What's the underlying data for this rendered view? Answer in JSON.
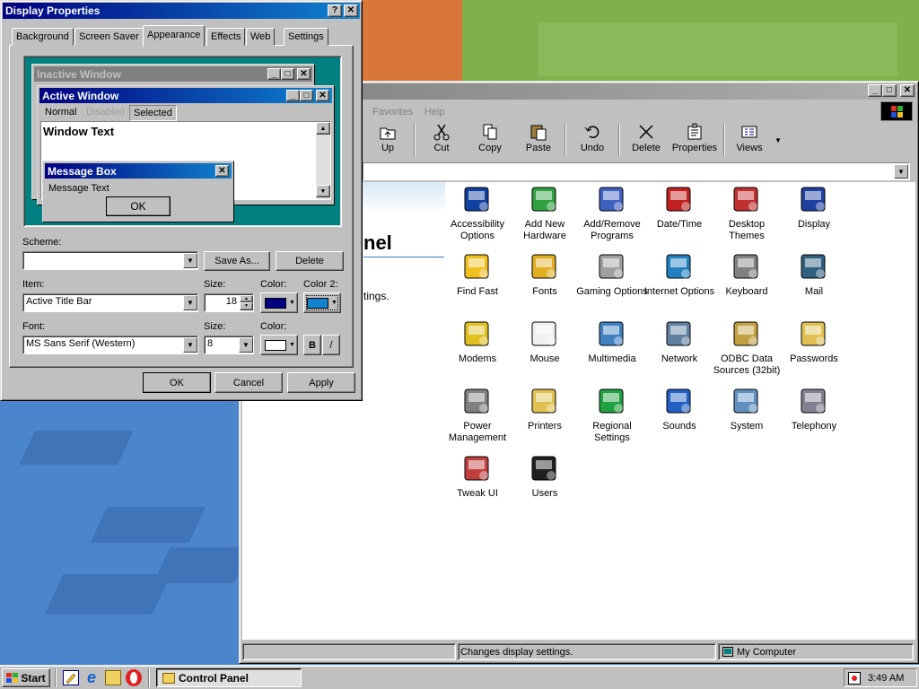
{
  "display_properties": {
    "title": "Display Properties",
    "help_btn": "?",
    "close_btn": "✕",
    "tabs": [
      "Background",
      "Screen Saver",
      "Appearance",
      "Effects",
      "Web",
      "Settings"
    ],
    "preview": {
      "inactive_title": "Inactive Window",
      "active_title": "Active Window",
      "menu": [
        "Normal",
        "Disabled",
        "Selected"
      ],
      "window_text": "Window Text",
      "msgbox_title": "Message Box",
      "msgbox_text": "Message Text",
      "msgbox_ok": "OK"
    },
    "scheme_label": "Scheme:",
    "scheme_value": "",
    "save_as": "Save As...",
    "delete": "Delete",
    "item_label": "Item:",
    "item_value": "Active Title Bar",
    "size_label": "Size:",
    "item_size": "18",
    "color_label": "Color:",
    "color2_label": "Color 2:",
    "font_label": "Font:",
    "font_value": "MS Sans Serif (Western)",
    "font_size_label": "Size:",
    "font_size": "8",
    "font_color_label": "Color:",
    "bold_btn": "B",
    "italic_btn": "/",
    "ok": "OK",
    "cancel": "Cancel",
    "apply": "Apply"
  },
  "control_panel": {
    "menu": [
      "Favorites",
      "Help"
    ],
    "toolbar": [
      "Up",
      "Cut",
      "Copy",
      "Paste",
      "Undo",
      "Delete",
      "Properties",
      "Views"
    ],
    "side_title": "nel",
    "side_text": "tings.",
    "items": [
      "Accessibility Options",
      "Add New Hardware",
      "Add/Remove Programs",
      "Date/Time",
      "Desktop Themes",
      "Display",
      "Find Fast",
      "Fonts",
      "Gaming Options",
      "Internet Options",
      "Keyboard",
      "Mail",
      "Modems",
      "Mouse",
      "Multimedia",
      "Network",
      "ODBC Data Sources (32bit)",
      "Passwords",
      "Power Management",
      "Printers",
      "Regional Settings",
      "Sounds",
      "System",
      "Telephony",
      "Tweak UI",
      "Users"
    ],
    "status_text": "Changes display settings.",
    "status_zone": "My Computer"
  },
  "taskbar": {
    "start": "Start",
    "task": "Control Panel",
    "clock": "3:49 AM"
  },
  "colors": {
    "active_title_start": "#000080",
    "active_title_end": "#1084d0",
    "inactive_title": "#808080",
    "preview_bg": "#008080",
    "color_swatch": "#000080",
    "color2_swatch": "#1084d0"
  }
}
